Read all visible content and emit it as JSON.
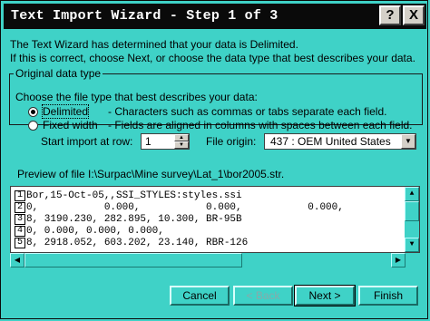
{
  "window": {
    "title": "Text Import Wizard - Step 1 of 3",
    "help_button": "?",
    "close_button": "X"
  },
  "intro": {
    "line1": "The Text Wizard has determined that your data is Delimited.",
    "line2": "If this is correct, choose Next, or choose the data type that best describes your data."
  },
  "data_type": {
    "legend": "Original data type",
    "prompt": "Choose the file type that best describes your data:",
    "options": [
      {
        "label": "Delimited",
        "description": "- Characters such as commas or tabs separate each field.",
        "selected": true
      },
      {
        "label": "Fixed width",
        "description": "- Fields are aligned in columns with spaces between each field.",
        "selected": false
      }
    ]
  },
  "start_row": {
    "label": "Start import at row:",
    "value": "1"
  },
  "file_origin": {
    "label": "File origin:",
    "value": "437 : OEM United States"
  },
  "preview": {
    "label": "Preview of file I:\\Surpac\\Mine survey\\Lat_1\\bor2005.str.",
    "rows": [
      {
        "num": "1",
        "text": "Bor,15-Oct-05,,SSI_STYLES:styles.ssi"
      },
      {
        "num": "2",
        "text": "0,           0.000,           0.000,           0.000,"
      },
      {
        "num": "3",
        "text": "8, 3190.230, 282.895, 10.300, BR-95B"
      },
      {
        "num": "4",
        "text": "0, 0.000, 0.000, 0.000,"
      },
      {
        "num": "5",
        "text": "8, 2918.052, 603.202, 23.140, RBR-126"
      }
    ]
  },
  "buttons": {
    "cancel": "Cancel",
    "back": "< Back",
    "next": "Next >",
    "finish": "Finish"
  },
  "colors": {
    "background": "#3fd2c7",
    "titlebar": "#0a0a0a"
  }
}
